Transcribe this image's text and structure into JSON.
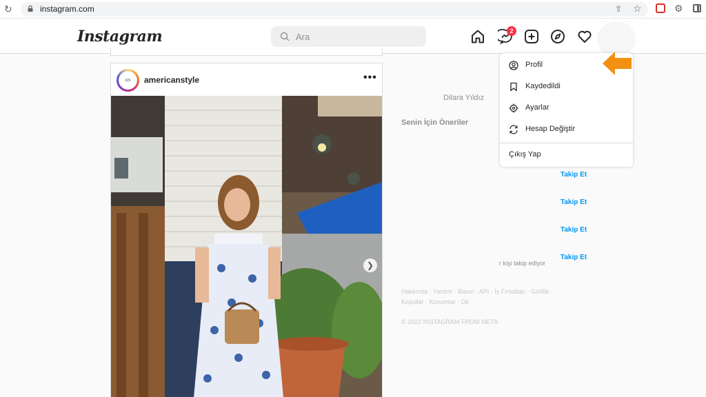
{
  "browser": {
    "url": "instagram.com"
  },
  "header": {
    "logo": "Instagram",
    "search_placeholder": "Ara",
    "messages_badge": "2"
  },
  "post": {
    "username": "americanstyle",
    "avatar_text": "as",
    "more": "•••"
  },
  "sidebar": {
    "name": "Dilara Yıldız",
    "suggestions_title": "Senin İçin Öneriler",
    "follow_labels": [
      "Takip Et",
      "Takip Et",
      "Takip Et",
      "Takip Et"
    ],
    "followed_by": "r kişi takip ediyor",
    "footer_line1": "Hakkında · Yardım · Basın · API · İş Fırsatları · Gizlilik ·",
    "footer_line2": "Koşullar · Konumlar · Dil",
    "copyright": "© 2022 INSTAGRAM FROM META"
  },
  "menu": {
    "items": [
      {
        "label": "Profil",
        "icon": "profile-icon"
      },
      {
        "label": "Kaydedildi",
        "icon": "bookmark-icon"
      },
      {
        "label": "Ayarlar",
        "icon": "settings-icon"
      },
      {
        "label": "Hesap Değiştir",
        "icon": "switch-account-icon"
      }
    ],
    "logout": "Çıkış Yap"
  },
  "colors": {
    "accent_blue": "#0095f6",
    "badge_red": "#ff3040",
    "arrow_orange": "#f29111"
  }
}
